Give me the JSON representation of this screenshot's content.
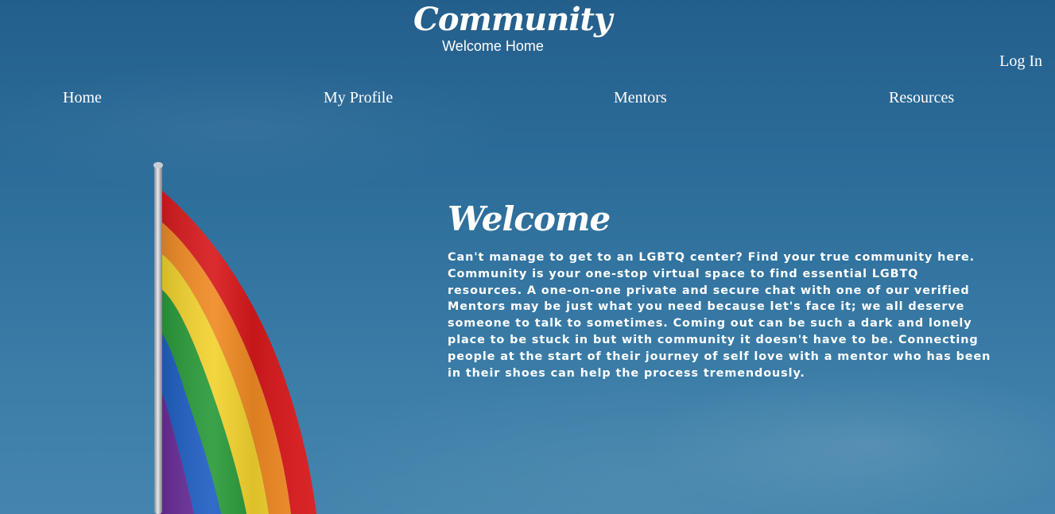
{
  "header": {
    "title": "Community",
    "subtitle": "Welcome Home",
    "login_label": "Log In"
  },
  "nav": {
    "items": [
      {
        "label": "Home"
      },
      {
        "label": "My Profile"
      },
      {
        "label": "Mentors"
      },
      {
        "label": "Resources"
      }
    ]
  },
  "main": {
    "heading": "Welcome",
    "body": "Can't manage to get to an LGBTQ center? Find your true community here. Community is your one-stop virtual space to find essential LGBTQ resources. A one-on-one private and secure chat with one of our verified Mentors may be just what you need because let's face it; we all deserve someone to talk to sometimes. Coming out can be such a dark and lonely place to be stuck in but with community it doesn't have to be. Connecting people at the start of their journey of self love with a mentor who has been in their shoes can help the process tremendously."
  },
  "colors": {
    "sky_top": "#245f8c",
    "sky_bottom": "#4585ad",
    "text": "#ffffff",
    "flag_red": "#d7191c",
    "flag_orange": "#f08a24",
    "flag_yellow": "#f2d22e",
    "flag_green": "#2a9a3a",
    "flag_blue": "#1f5fc4",
    "flag_purple": "#6a2d9a"
  },
  "icons": {
    "flag": "rainbow-pride-flag"
  }
}
